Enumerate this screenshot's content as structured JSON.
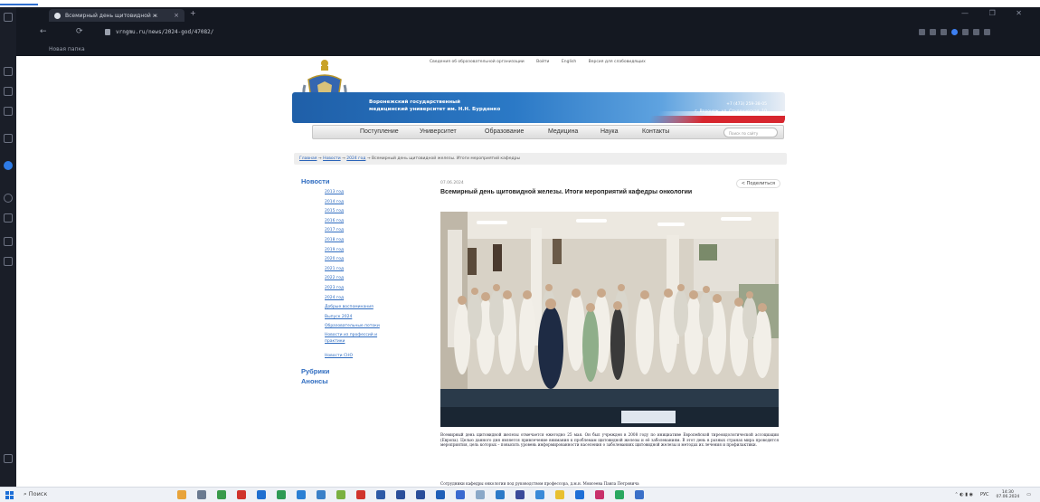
{
  "browser": {
    "tab_title": "Всемирный день щитовидной ж",
    "tab_close": "×",
    "new_tab": "+",
    "window_controls": "— ❐ ✕",
    "nav_back": "←",
    "nav_refresh": "⟳",
    "url": "vrngmu.ru/news/2024-god/47082/",
    "bookmarks_label": "Новая папка",
    "accent_color": "#2e7be6"
  },
  "site": {
    "top_links": [
      "Сведения об образовательной организации",
      "Войти",
      "English",
      "Версия для слабовидящих"
    ],
    "university_name_line1": "Воронежский государственный",
    "university_name_line2": "медицинский университет им. Н.Н. Бурденко",
    "contacts_line1": "+7 (473) 259-38-05",
    "contacts_line2": "г. Воронеж, ул. Студенческая, 10",
    "nav": [
      "Поступление",
      "Университет",
      "Образование",
      "Медицина",
      "Наука",
      "Контакты"
    ],
    "search_placeholder": "Поиск по сайту",
    "breadcrumb": {
      "home": "Главная",
      "news": "Новости",
      "year": "2024 год",
      "current": "Всемирный день щитовидной железы. Итоги мероприятий кафедры"
    }
  },
  "sidebar_menu": {
    "news_heading": "Новости",
    "years": [
      "2013 год",
      "2014 год",
      "2015 год",
      "2016 год",
      "2017 год",
      "2018 год",
      "2019 год",
      "2020 год",
      "2021 год",
      "2022 год",
      "2023 год",
      "2024 год"
    ],
    "extra": [
      "Добрые воспоминания",
      "Выпуск 2024",
      "Образовательные потоки",
      "Новости из профессий и практики",
      "Новости СНО"
    ],
    "rubrics": "Рубрики",
    "announcements": "Анонсы"
  },
  "article": {
    "date": "07.06.2024",
    "share": "Поделиться",
    "title": "Всемирный день щитовидной железы. Итоги мероприятий кафедры онкологии",
    "paragraph1": "Всемирный день щитовидной железы отмечается ежегодно 25 мая. Он был учрежден в 2008 году по инициативе Европейской тиреоидологической ассоциации (Европа). Целью данного дня является привлечение внимания к проблемам щитовидной железы и её заболеваниям. В этот день в разных странах мира проводятся мероприятия, цель которых – повысить уровень информированности населения о заболеваниях щитовидной железы и методах их лечения и профилактики.",
    "paragraph2": "Сотрудники кафедры онкологии под руководством профессора, д.м.н. Моисеева Павла Петровича"
  },
  "taskbar": {
    "search": "Поиск",
    "tray_lang": "РУС",
    "time": "14:30",
    "date": "07.06.2024"
  }
}
